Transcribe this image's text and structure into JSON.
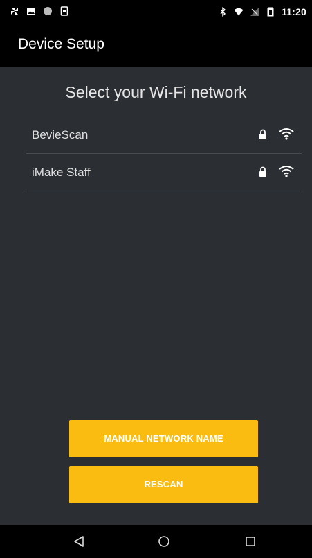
{
  "status_bar": {
    "time": "11:20",
    "left_icons": [
      "pinwheel-icon",
      "image-icon",
      "dot-icon",
      "device-icon"
    ],
    "right_icons": [
      "bluetooth-icon",
      "wifi-signal-icon",
      "cell-no-signal-icon",
      "battery-icon"
    ]
  },
  "app_bar": {
    "title": "Device Setup"
  },
  "main": {
    "heading": "Select your Wi-Fi network",
    "networks": [
      {
        "name": "BevieScan",
        "secured": true,
        "signal": "full"
      },
      {
        "name": "iMake Staff",
        "secured": true,
        "signal": "full"
      }
    ]
  },
  "buttons": {
    "manual_label": "MANUAL NETWORK NAME",
    "rescan_label": "RESCAN"
  },
  "nav_bar": {
    "icons": [
      "back-icon",
      "home-icon",
      "recents-icon"
    ]
  },
  "colors": {
    "background": "#2b2f34",
    "bars": "#000000",
    "accent": "#fbbc12"
  }
}
